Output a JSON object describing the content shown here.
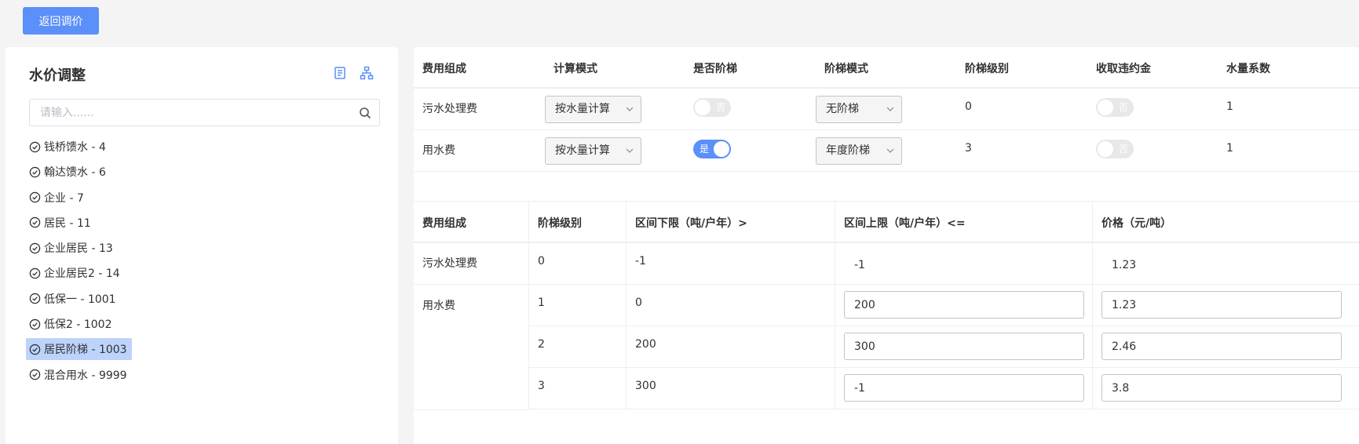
{
  "header": {
    "back_label": "返回调价"
  },
  "sidebar": {
    "title": "水价调整",
    "search_placeholder": "请输入......",
    "items": [
      {
        "label": "钱桥馈水 - 4",
        "selected": false
      },
      {
        "label": "翰达馈水 - 6",
        "selected": false
      },
      {
        "label": "企业 - 7",
        "selected": false
      },
      {
        "label": "居民 - 11",
        "selected": false
      },
      {
        "label": "企业居民 - 13",
        "selected": false
      },
      {
        "label": "企业居民2 - 14",
        "selected": false
      },
      {
        "label": "低保一 - 1001",
        "selected": false
      },
      {
        "label": "低保2 - 1002",
        "selected": false
      },
      {
        "label": "居民阶梯 - 1003",
        "selected": true
      },
      {
        "label": "混合用水 - 9999",
        "selected": false
      }
    ]
  },
  "fee_table": {
    "headers": [
      "费用组成",
      "计算模式",
      "是否阶梯",
      "阶梯模式",
      "阶梯级别",
      "收取违约金",
      "水量系数"
    ],
    "rows": [
      {
        "fee": "污水处理费",
        "calc_mode": "按水量计算",
        "tiered_label": "否",
        "tier_mode": "无阶梯",
        "tier_level": "0",
        "penalty_label": "否",
        "coefficient": "1"
      },
      {
        "fee": "用水费",
        "calc_mode": "按水量计算",
        "tiered_label": "是",
        "tier_mode": "年度阶梯",
        "tier_level": "3",
        "penalty_label": "否",
        "coefficient": "1"
      }
    ]
  },
  "tier_table": {
    "headers": [
      "费用组成",
      "阶梯级别",
      "区间下限（吨/户年）>",
      "区间上限（吨/户年）<=",
      "价格（元/吨）"
    ],
    "row0": {
      "fee": "污水处理费",
      "level": "0",
      "lower": "-1",
      "upper": "-1",
      "price": "1.23"
    },
    "group_fee": "用水费",
    "rows": [
      {
        "level": "1",
        "lower": "0",
        "upper": "200",
        "price": "1.23"
      },
      {
        "level": "2",
        "lower": "200",
        "upper": "300",
        "price": "2.46"
      },
      {
        "level": "3",
        "lower": "300",
        "upper": "-1",
        "price": "3.8"
      }
    ]
  },
  "colors": {
    "accent": "#5b8ff9",
    "selected_bg": "#bed3fb"
  }
}
